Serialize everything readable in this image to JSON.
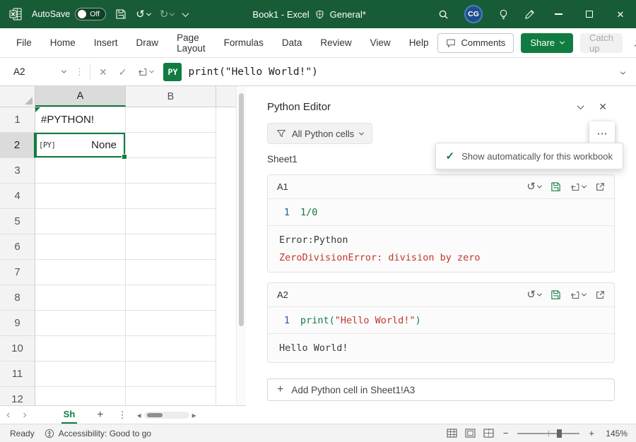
{
  "colors": {
    "titlebar_green": "#185C37",
    "accent_green": "#107C41",
    "error_red": "#C0392B",
    "line_number_blue": "#2B579A",
    "avatar_blue": "#1E4E8C"
  },
  "icons": {
    "undo": "↺",
    "redo": "↻",
    "close": "✕",
    "check": "✓",
    "dots_horizontal": "⋯",
    "dots_vertical": "⋮",
    "sheet_prev": "‹",
    "sheet_next": "›",
    "scroll_left": "◂",
    "scroll_right": "▸",
    "plus": "+",
    "minus": "−"
  },
  "titlebar": {
    "autosave_label": "AutoSave",
    "autosave_state": "Off",
    "title": "Book1 - Excel",
    "sensitivity_label": "General*",
    "avatar_initials": "CG"
  },
  "ribbon": {
    "tabs": [
      "File",
      "Home",
      "Insert",
      "Draw",
      "Page Layout",
      "Formulas",
      "Data",
      "Review",
      "View",
      "Help"
    ],
    "comments_label": "Comments",
    "share_label": "Share",
    "catch_up_label": "Catch up"
  },
  "formula_bar": {
    "name_box_value": "A2",
    "py_badge": "PY",
    "formula_text": "print(\"Hello World!\")"
  },
  "grid": {
    "column_headers": [
      "A",
      "B"
    ],
    "row_numbers": [
      "1",
      "2",
      "3",
      "4",
      "5",
      "6",
      "7",
      "8",
      "9",
      "10",
      "11",
      "12"
    ],
    "cells": {
      "a1_value": "#PYTHON!",
      "a2_icon": "[PY]",
      "a2_value": "None"
    },
    "sheet_tab_label": "Sh"
  },
  "python_editor": {
    "title": "Python Editor",
    "filter_label": "All Python cells",
    "sheet_label": "Sheet1",
    "tooltip_text": "Show automatically for this workbook",
    "cards": [
      {
        "cell_ref": "A1",
        "line_number": "1",
        "code_parts": [
          {
            "text": "1/0"
          }
        ],
        "output_lines": [
          {
            "text": "Error:Python"
          },
          {
            "text": "ZeroDivisionError: division by zero"
          }
        ]
      },
      {
        "cell_ref": "A2",
        "line_number": "1",
        "code_parts": [
          {
            "text": "print("
          },
          {
            "text": "\"Hello World!\""
          },
          {
            "text": ")"
          }
        ],
        "output_lines": [
          {
            "text": "Hello World!"
          }
        ]
      }
    ],
    "add_cell_label": "Add Python cell in Sheet1!A3"
  },
  "status_bar": {
    "ready_label": "Ready",
    "accessibility_label": "Accessibility: Good to go",
    "zoom_level": "145%"
  }
}
